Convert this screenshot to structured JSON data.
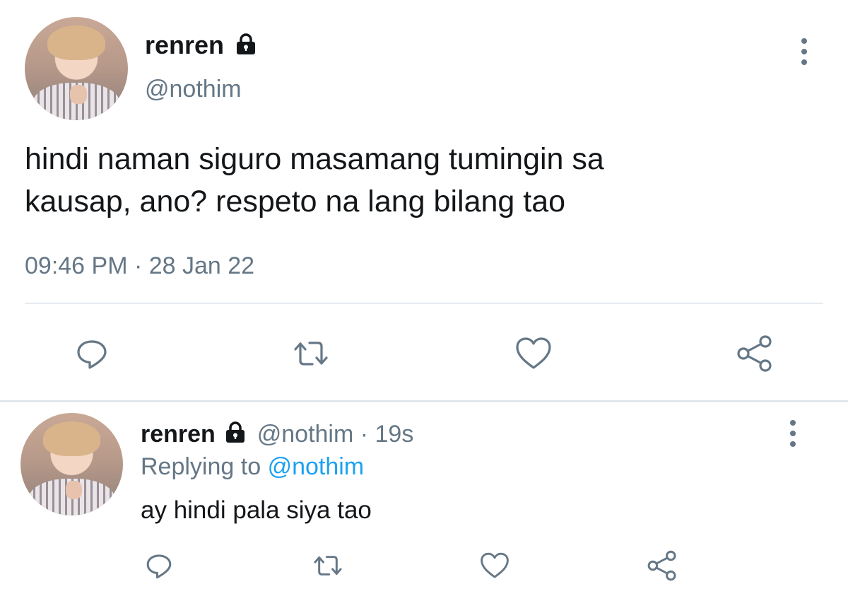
{
  "main_tweet": {
    "display_name": "renren",
    "handle": "@nothim",
    "text_line1": "hindi naman siguro masamang tumingin sa",
    "text_line2": "kausap, ano? respeto na lang bilang tao",
    "timestamp": "09:46 PM · 28 Jan 22",
    "protected_icon": "lock-icon",
    "actions": [
      "reply-icon",
      "retweet-icon",
      "like-icon",
      "share-icon"
    ]
  },
  "reply_tweet": {
    "display_name": "renren",
    "handle_time": "@nothim · 19s",
    "replying_prefix": "Replying to",
    "replying_handle": "@nothim",
    "text": "ay hindi pala siya tao",
    "protected_icon": "lock-icon",
    "actions": [
      "reply-icon",
      "retweet-icon",
      "like-icon",
      "share-icon"
    ]
  },
  "colors": {
    "text": "#14171a",
    "muted": "#657786",
    "link": "#1da1f2",
    "divider": "#e6ecf0"
  }
}
